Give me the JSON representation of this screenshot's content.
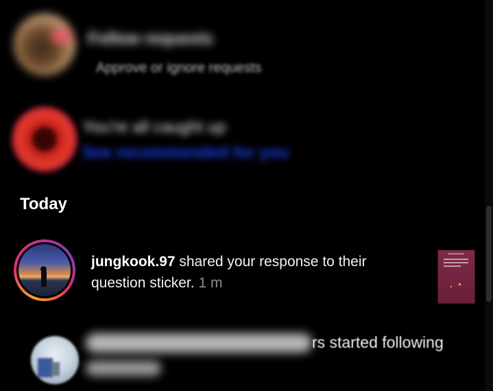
{
  "requests_row": {
    "title": "Follow requests",
    "subtitle": "Approve or ignore requests"
  },
  "mention_row": {
    "title": "You're all caught up",
    "link": "See recommended for you"
  },
  "section": {
    "today_label": "Today"
  },
  "notification": {
    "username": "jungkook.97",
    "message": " shared your response to their question sticker.",
    "time": "1 m"
  },
  "follow_row": {
    "text": "rs started following",
    "time_blurred": ""
  },
  "colors": {
    "background": "#000000",
    "link": "#1b3ff0",
    "thumbnail": "#7d2a46",
    "story_ring": "#e1306c"
  }
}
